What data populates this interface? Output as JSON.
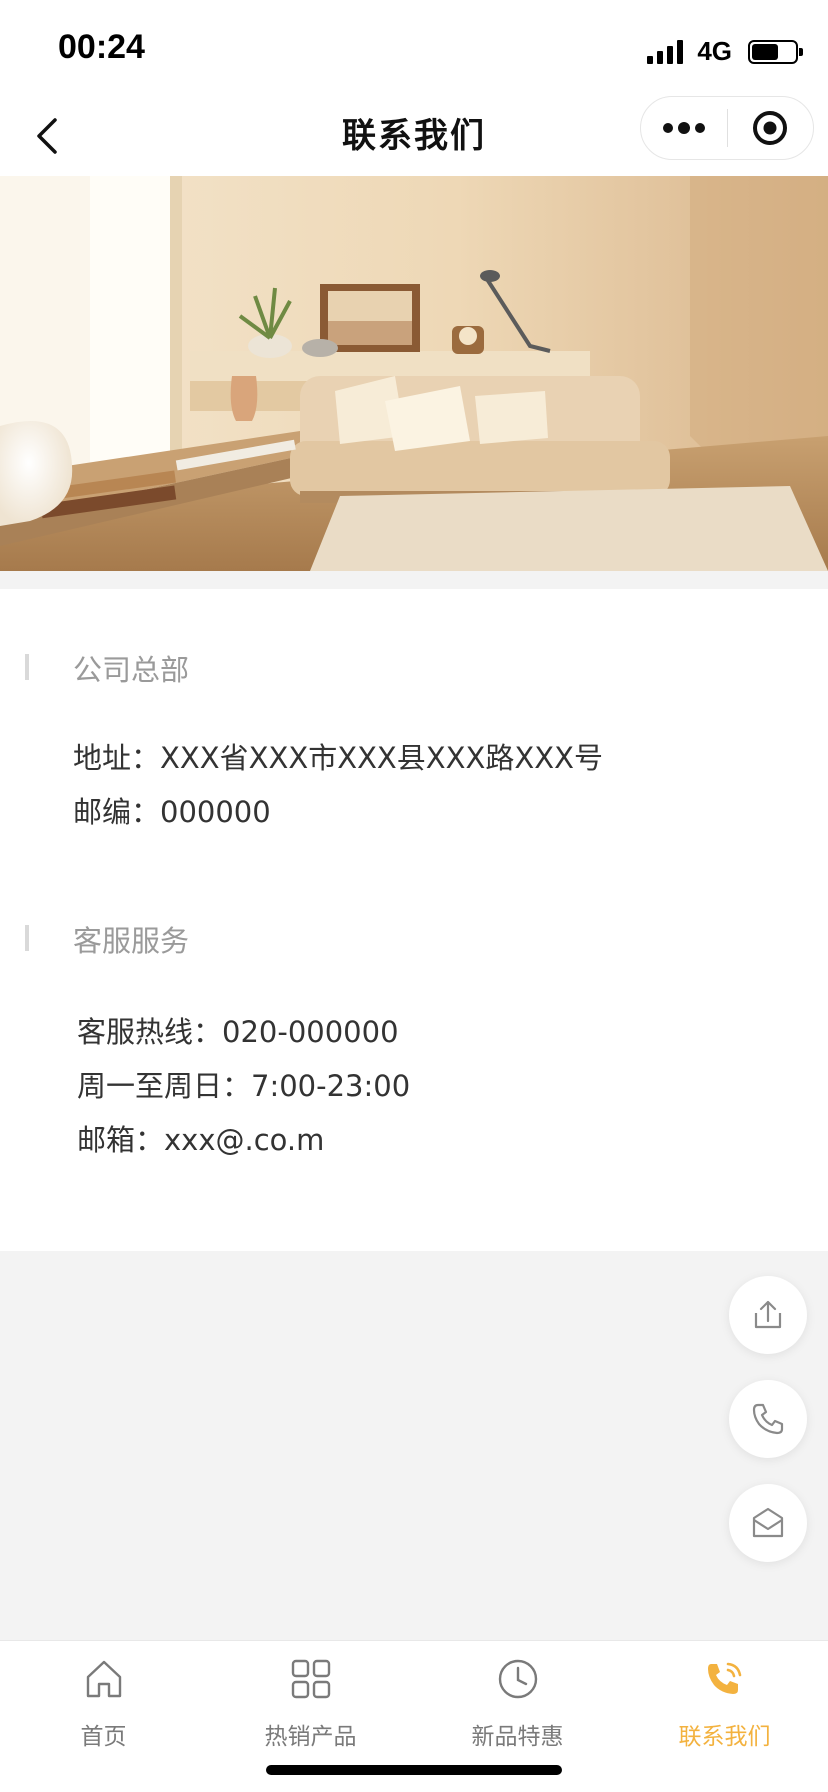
{
  "status_bar": {
    "time": "00:24",
    "network": "4G"
  },
  "nav": {
    "title": "联系我们",
    "more_icon": "more-dots-icon",
    "close_icon": "target-circle-icon"
  },
  "hero": {
    "image": "living-room-photo"
  },
  "headquarters": {
    "title": "公司总部",
    "address": "地址：XXX省XXX市XXX县XXX路XXX号",
    "postcode": "邮编：000000"
  },
  "service": {
    "title": "客服服务",
    "hotline": "客服热线：020-000000",
    "hours": "周一至周日：7:00-23:00",
    "email": "邮箱：xxx@.co.m"
  },
  "fabs": {
    "share": "share-icon",
    "phone": "phone-icon",
    "message": "mail-icon"
  },
  "tabs": [
    {
      "label": "首页",
      "icon": "home-icon"
    },
    {
      "label": "热销产品",
      "icon": "grid-icon"
    },
    {
      "label": "新品特惠",
      "icon": "clock-icon"
    },
    {
      "label": "联系我们",
      "icon": "phone-call-icon"
    }
  ],
  "colors": {
    "accent": "#f3b23f",
    "title_gray": "#9a9a9a",
    "text": "#333333",
    "page_bg": "#f3f3f3"
  }
}
